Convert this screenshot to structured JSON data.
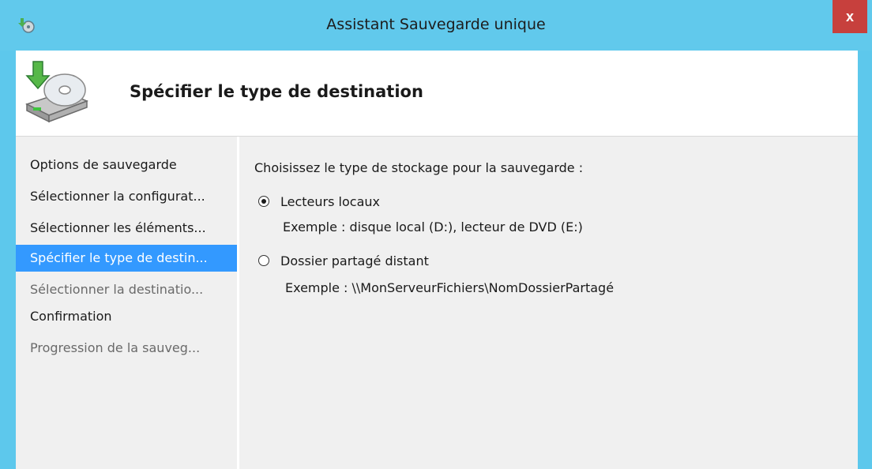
{
  "window": {
    "title": "Assistant Sauvegarde unique",
    "close_label": "x"
  },
  "header": {
    "title": "Spécifier le type de destination",
    "icon": "backup-disk-icon"
  },
  "nav": {
    "items": [
      {
        "label": "Options de sauvegarde",
        "state": "normal"
      },
      {
        "label": "Sélectionner la configurat...",
        "state": "normal"
      },
      {
        "label": "Sélectionner les éléments...",
        "state": "normal"
      },
      {
        "label": "Spécifier le type de destin...",
        "state": "selected"
      },
      {
        "label": "Sélectionner la destinatio...",
        "state": "disabled"
      },
      {
        "label": "Confirmation",
        "state": "normal"
      },
      {
        "label": "Progression de la sauveg...",
        "state": "disabled"
      }
    ]
  },
  "main": {
    "prompt": "Choisissez le type de stockage pour la sauvegarde :",
    "options": [
      {
        "label": "Lecteurs locaux",
        "example": "Exemple : disque local (D:), lecteur de DVD (E:)",
        "checked": true
      },
      {
        "label": "Dossier partagé distant",
        "example": "Exemple : \\\\MonServeurFichiers\\NomDossierPartagé",
        "checked": false
      }
    ]
  },
  "colors": {
    "titlebar": "#61c9ec",
    "close": "#c7403d",
    "selection": "#3399ff",
    "panel": "#f0f0f0"
  }
}
